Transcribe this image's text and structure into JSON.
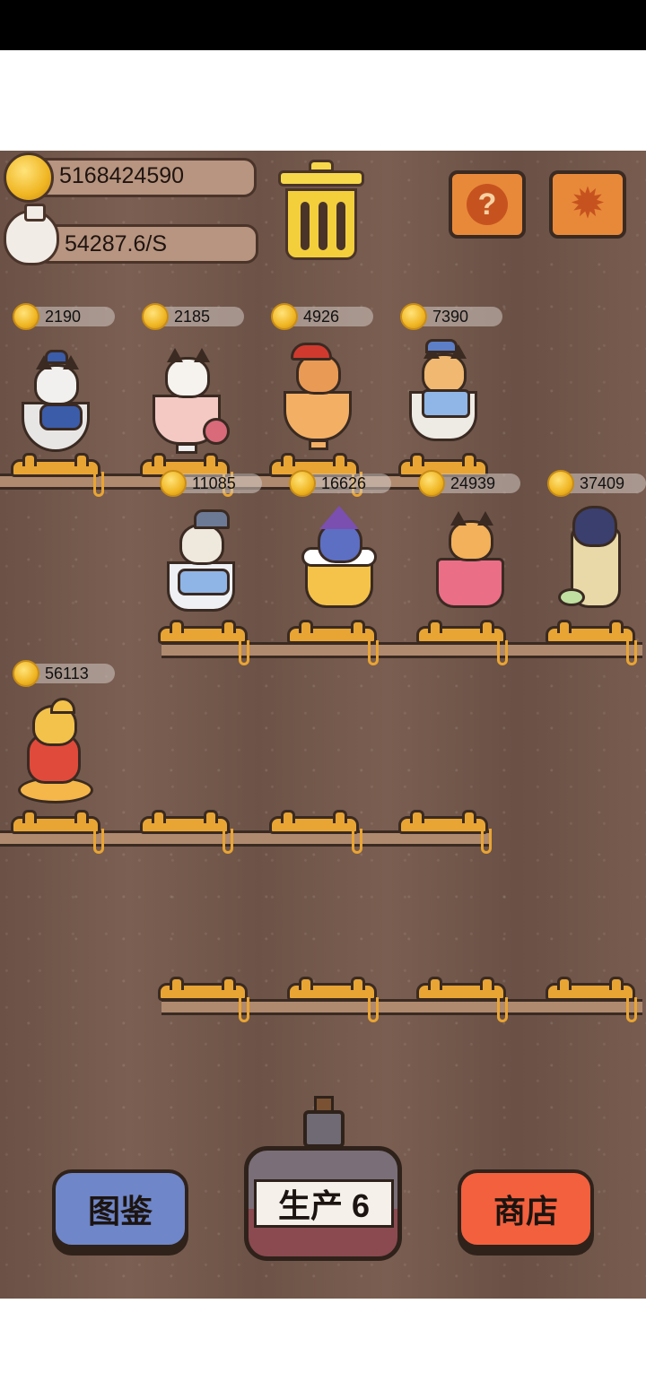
{
  "hud": {
    "coins": "5168424590",
    "income_rate": "54287.6/S",
    "trash_icon": "trash-can-icon",
    "help_icon": "question-mark-icon",
    "settings_icon": "gear-icon"
  },
  "shelves": [
    {
      "slots": [
        {
          "price": "2190",
          "cat": "emperor-cat-in-bowl"
        },
        {
          "price": "2185",
          "cat": "rose-cat-in-goblet"
        },
        {
          "price": "4926",
          "cat": "pirate-cat-in-cocktail"
        },
        {
          "price": "7390",
          "cat": "scholar-cat-in-teacup"
        }
      ]
    },
    {
      "slots": [
        {
          "price": "11085",
          "cat": "detective-cat-in-glass"
        },
        {
          "price": "16626",
          "cat": "wizard-cat-in-beer-mug"
        },
        {
          "price": "24939",
          "cat": "striped-cat-in-tumbler"
        },
        {
          "price": "37409",
          "cat": "black-cat-in-parfait"
        }
      ]
    },
    {
      "slots": [
        {
          "price": "56113",
          "cat": "golden-cat-on-tray"
        },
        {
          "price": null,
          "cat": null
        },
        {
          "price": null,
          "cat": null
        },
        {
          "price": null,
          "cat": null
        }
      ]
    },
    {
      "slots": [
        {
          "price": null,
          "cat": null
        },
        {
          "price": null,
          "cat": null
        },
        {
          "price": null,
          "cat": null
        },
        {
          "price": null,
          "cat": null
        }
      ]
    }
  ],
  "buttons": {
    "collection_label": "图鉴",
    "produce_label": "生产 6",
    "shop_label": "商店"
  },
  "colors": {
    "wood_bg": "#6f5448",
    "coin_gold": "#f0b623",
    "slot_orange": "#e9a533",
    "collection_blue": "#6f86c8",
    "shop_red": "#f2603e",
    "button_orange": "#e8893a"
  }
}
